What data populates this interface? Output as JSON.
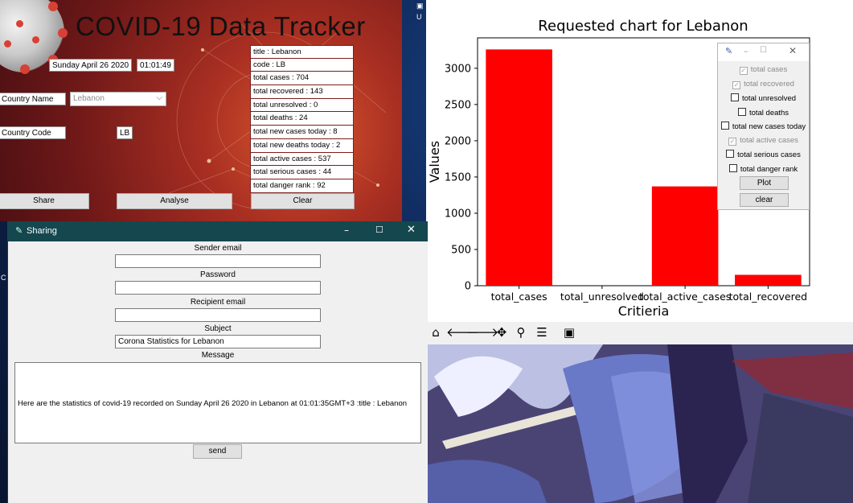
{
  "tracker": {
    "title": "COVID-19 Data Tracker",
    "date": "Sunday April 26 2020",
    "time": "01:01:49",
    "country_name_label": "Country Name",
    "country_name_value": "Lebanon",
    "country_code_label": "Country Code",
    "country_code_value": "LB",
    "stats": [
      "title : Lebanon",
      "code : LB",
      "total cases : 704",
      "total recovered : 143",
      "total unresolved : 0",
      "total deaths : 24",
      "total new cases today : 8",
      "total new deaths today : 2",
      "total active cases : 537",
      "total serious cases : 44",
      "total danger rank : 92"
    ],
    "share_label": "Share",
    "analyse_label": "Analyse",
    "clear_label": "Clear"
  },
  "chart_window": {
    "toolbar_icons": [
      "home-icon",
      "back-arrow-icon",
      "forward-arrow-icon",
      "pan-icon",
      "zoom-icon",
      "configure-icon",
      "save-icon"
    ]
  },
  "chart_data": {
    "type": "bar",
    "title": "Requested chart for Lebanon",
    "xlabel": "Critieria",
    "ylabel": "Values",
    "categories": [
      "total_cases",
      "total_unresolved",
      "total_active_cases",
      "total_recovered"
    ],
    "values": [
      3260,
      0,
      1370,
      150
    ],
    "ylim": [
      0,
      3420
    ],
    "yticks": [
      0,
      500,
      1000,
      1500,
      2000,
      2500,
      3000
    ],
    "bar_color": "#ff0000",
    "grid": false
  },
  "popup": {
    "options": [
      {
        "label": "total cases",
        "checked": true,
        "disabled": true
      },
      {
        "label": "total recovered",
        "checked": true,
        "disabled": true
      },
      {
        "label": "total unresolved",
        "checked": false,
        "disabled": false
      },
      {
        "label": "total deaths",
        "checked": false,
        "disabled": false
      },
      {
        "label": "total new cases today",
        "checked": false,
        "disabled": false
      },
      {
        "label": "total active cases",
        "checked": true,
        "disabled": true
      },
      {
        "label": "total serious cases",
        "checked": false,
        "disabled": false
      },
      {
        "label": "total danger rank",
        "checked": false,
        "disabled": false
      }
    ],
    "plot_label": "Plot",
    "clear_label": "clear"
  },
  "sharing": {
    "window_title": "Sharing",
    "sender_label": "Sender email",
    "sender_value": "",
    "password_label": "Password",
    "password_value": "",
    "recipient_label": "Recipient email",
    "recipient_value": "",
    "subject_label": "Subject",
    "subject_value": "Corona Statistics for Lebanon",
    "message_label": "Message",
    "message_value": "Here are the statistics of covid-19 recorded on Sunday April 26 2020 in Lebanon at 01:01:35GMT+3 :title : Lebanon",
    "send_label": "send"
  }
}
